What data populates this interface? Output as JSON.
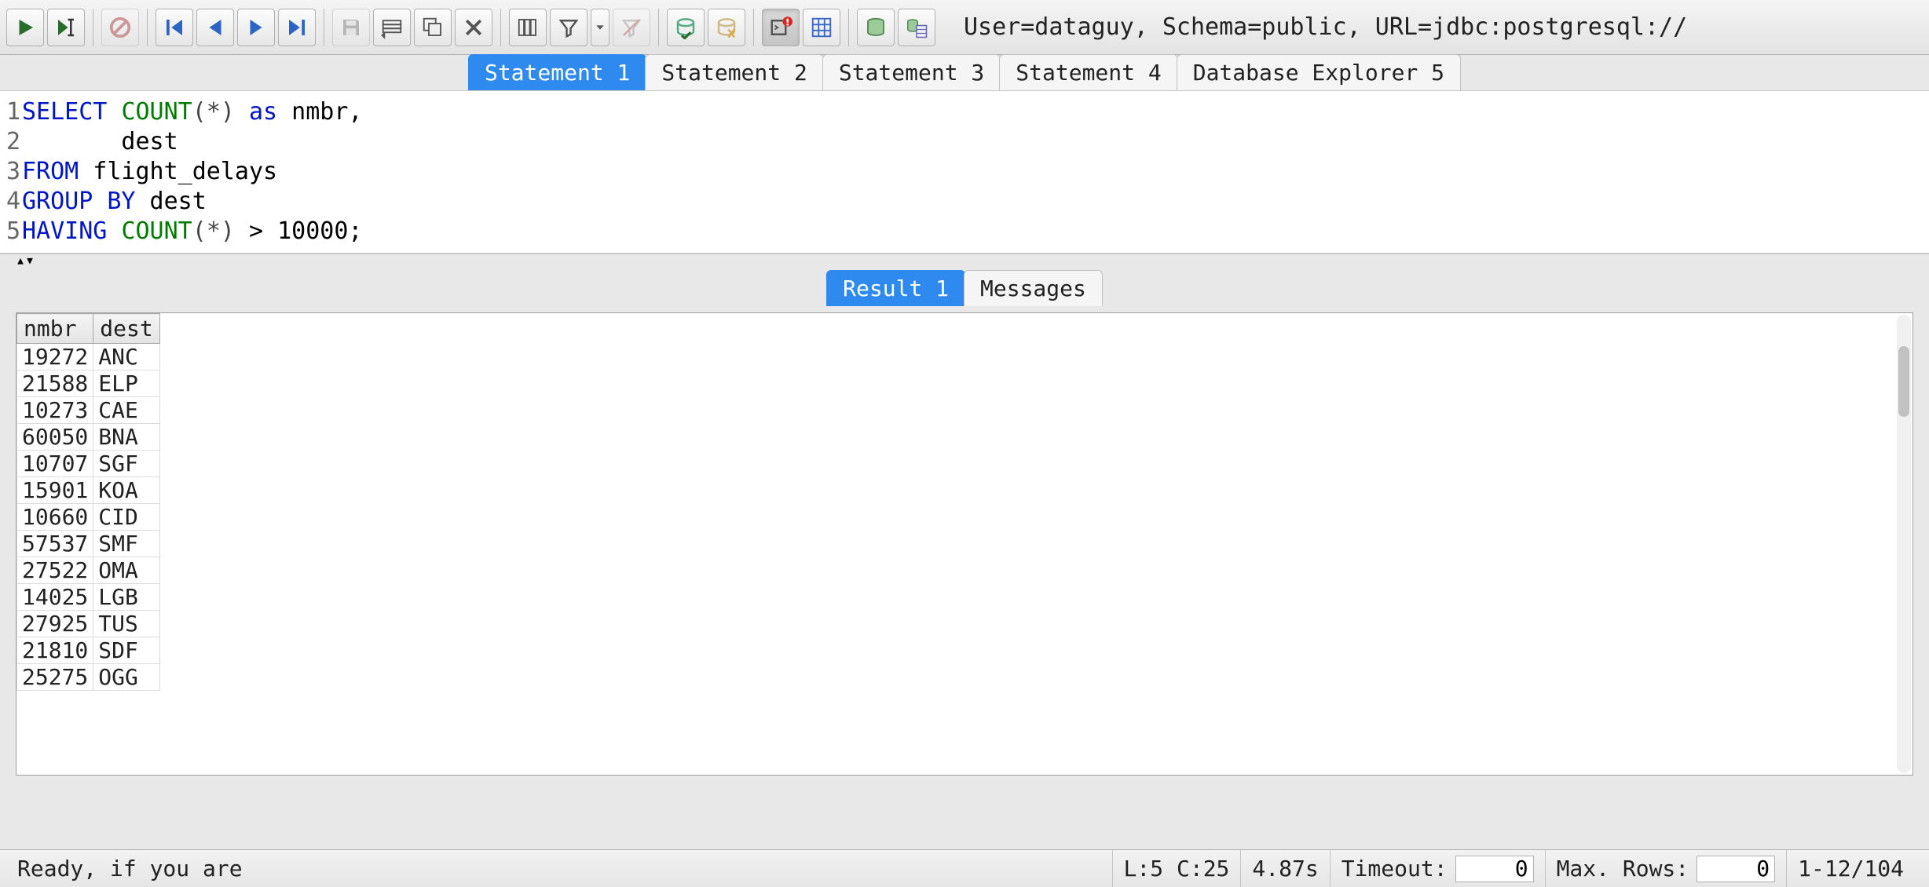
{
  "toolbar": {
    "connection_info": "User=dataguy, Schema=public, URL=jdbc:postgresql://"
  },
  "tabs": [
    {
      "label": "Statement 1",
      "active": true
    },
    {
      "label": "Statement 2",
      "active": false
    },
    {
      "label": "Statement 3",
      "active": false
    },
    {
      "label": "Statement 4",
      "active": false
    },
    {
      "label": "Database Explorer 5",
      "active": false
    }
  ],
  "sql": {
    "lines": [
      {
        "n": "1",
        "tokens": [
          [
            "kw",
            "SELECT"
          ],
          [
            "",
            " "
          ],
          [
            "fn",
            "COUNT"
          ],
          [
            "op",
            "("
          ],
          [
            "op",
            "*"
          ],
          [
            "op",
            ")"
          ],
          [
            "",
            " "
          ],
          [
            "kw",
            "as"
          ],
          [
            "",
            " nmbr,"
          ]
        ]
      },
      {
        "n": "2",
        "tokens": [
          [
            "",
            "       dest"
          ]
        ]
      },
      {
        "n": "3",
        "tokens": [
          [
            "kw",
            "FROM"
          ],
          [
            "",
            " flight_delays"
          ]
        ]
      },
      {
        "n": "4",
        "tokens": [
          [
            "kw",
            "GROUP BY"
          ],
          [
            "",
            " dest"
          ]
        ]
      },
      {
        "n": "5",
        "tokens": [
          [
            "kw",
            "HAVING"
          ],
          [
            "",
            " "
          ],
          [
            "fn",
            "COUNT"
          ],
          [
            "op",
            "("
          ],
          [
            "op",
            "*"
          ],
          [
            "op",
            ")"
          ],
          [
            "",
            " > 10000;"
          ]
        ]
      }
    ]
  },
  "result_tabs": [
    {
      "label": "Result 1",
      "active": true
    },
    {
      "label": "Messages",
      "active": false
    }
  ],
  "results": {
    "columns": [
      "nmbr",
      "dest"
    ],
    "rows": [
      [
        "19272",
        "ANC"
      ],
      [
        "21588",
        "ELP"
      ],
      [
        "10273",
        "CAE"
      ],
      [
        "60050",
        "BNA"
      ],
      [
        "10707",
        "SGF"
      ],
      [
        "15901",
        "KOA"
      ],
      [
        "10660",
        "CID"
      ],
      [
        "57537",
        "SMF"
      ],
      [
        "27522",
        "OMA"
      ],
      [
        "14025",
        "LGB"
      ],
      [
        "27925",
        "TUS"
      ],
      [
        "21810",
        "SDF"
      ],
      [
        "25275",
        "OGG"
      ]
    ]
  },
  "status": {
    "message": "Ready, if you are",
    "cursor": "L:5 C:25",
    "exec_time": "4.87s",
    "timeout_label": "Timeout:",
    "timeout_value": "0",
    "maxrows_label": "Max. Rows:",
    "maxrows_value": "0",
    "row_range": "1-12/104"
  }
}
